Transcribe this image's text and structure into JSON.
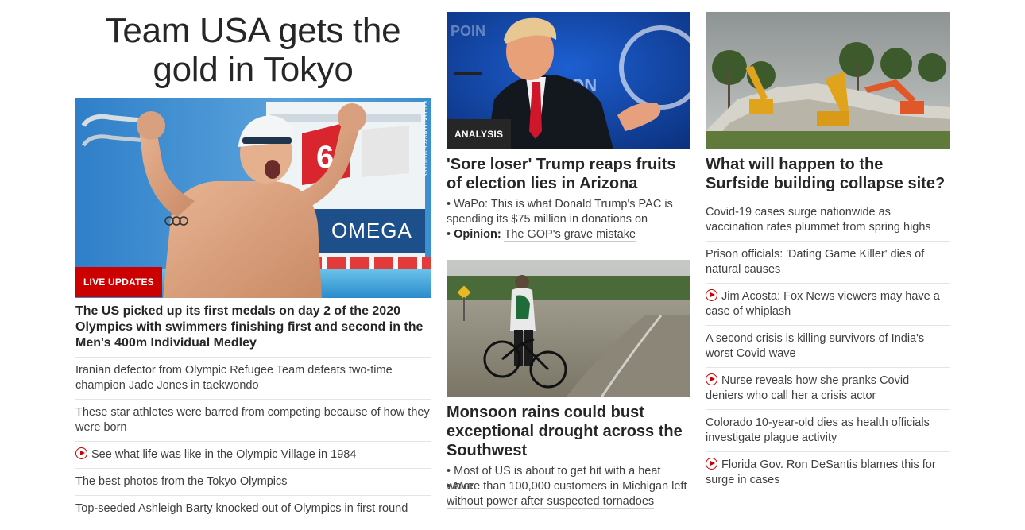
{
  "left": {
    "headline": "Team USA gets the gold in Tokyo",
    "image_credit": "KAI PFAFFENBACH/REUTERS",
    "badge": "LIVE UPDATES",
    "lead": "The US picked up its first medals on day 2 of the 2020 Olympics with swimmers finishing first and second in the Men's 400m Individual Medley",
    "items": [
      {
        "text": "Iranian defector from Olympic Refugee Team defeats two-time champion Jade Jones in taekwondo",
        "video": false
      },
      {
        "text": "These star athletes were barred from competing because of how they were born",
        "video": false
      },
      {
        "text": "See what life was like in the Olympic Village in 1984",
        "video": true
      },
      {
        "text": "The best photos from the Tokyo Olympics",
        "video": false
      },
      {
        "text": "Top-seeded Ashleigh Barty knocked out of Olympics in first round",
        "video": false
      }
    ],
    "pool_sign_text": "OMEGA",
    "lane_number": "6"
  },
  "middle": {
    "story1": {
      "badge": "ANALYSIS",
      "headline": "'Sore loser' Trump reaps fruits of election lies in Arizona",
      "bullets": [
        {
          "prefix": "",
          "text": "WaPo: This is what Donald Trump's PAC is spending its $75 million in donations on"
        },
        {
          "prefix": "Opinion:",
          "text": "The GOP's grave mistake"
        }
      ]
    },
    "story2": {
      "headline": "Monsoon rains could bust exceptional drought across the Southwest",
      "bullets": [
        {
          "text": "Most of US is about to get hit with a heat wave"
        },
        {
          "text": "More than 100,000 customers in Michigan left without power after suspected tornadoes"
        }
      ]
    }
  },
  "right": {
    "headline": "What will happen to the Surfside building collapse site?",
    "items": [
      {
        "text": "Covid-19 cases surge nationwide as vaccination rates plummet from spring highs",
        "video": false
      },
      {
        "text": "Prison officials: 'Dating Game Killer' dies of natural causes",
        "video": false
      },
      {
        "text": "Jim Acosta: Fox News viewers may have a case of whiplash",
        "video": true
      },
      {
        "text": "A second crisis is killing survivors of India's worst Covid wave",
        "video": false
      },
      {
        "text": "Nurse reveals how she pranks Covid deniers who call her a crisis actor",
        "video": true
      },
      {
        "text": "Colorado 10-year-old dies as health officials investigate plague activity",
        "video": false
      },
      {
        "text": "Florida Gov. Ron DeSantis blames this for surge in cases",
        "video": true
      }
    ]
  },
  "colors": {
    "accent": "#cc0000",
    "text": "#262626",
    "muted": "#404040",
    "divider": "#e4e4e4"
  }
}
